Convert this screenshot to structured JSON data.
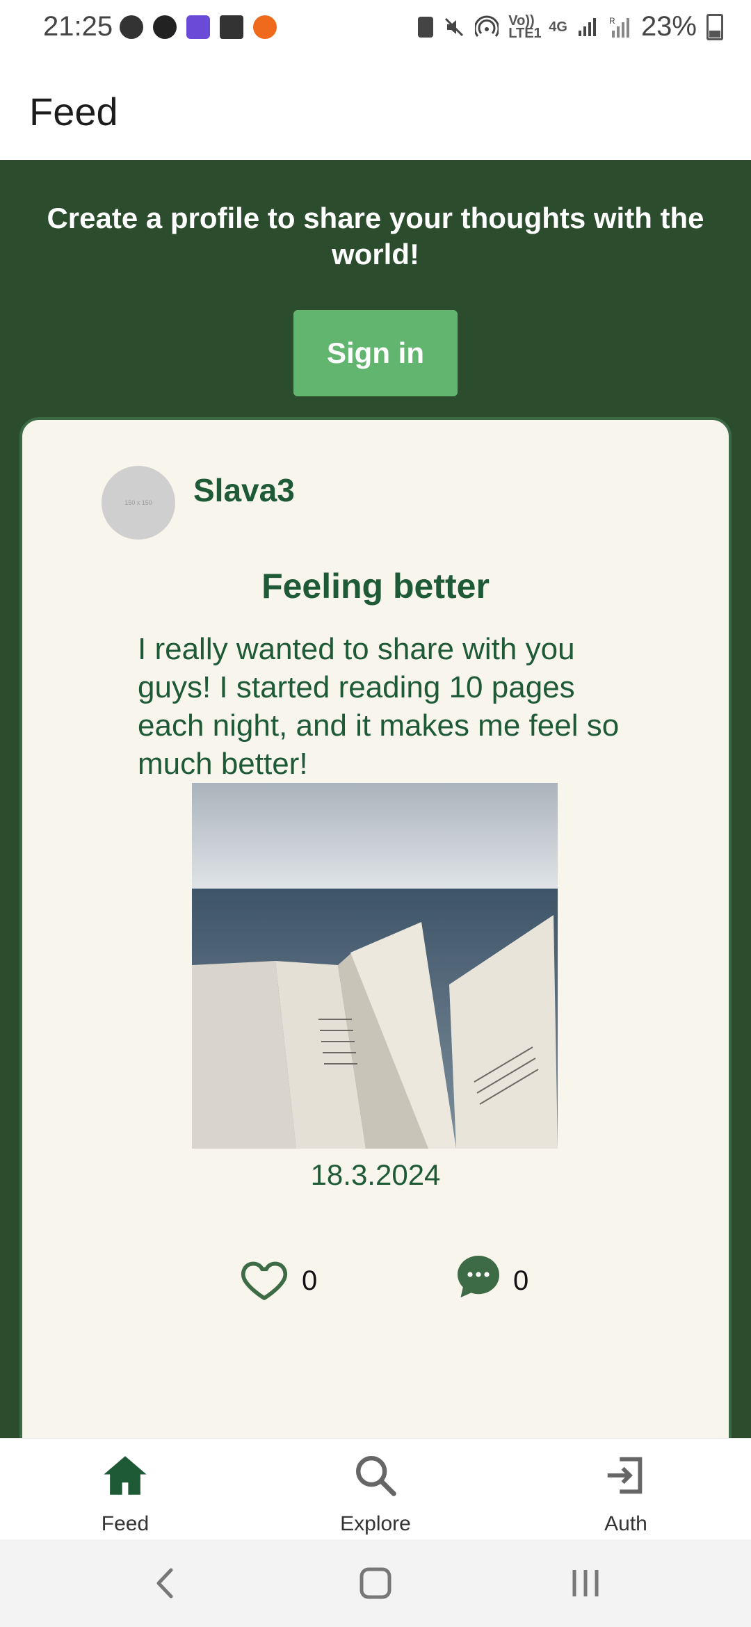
{
  "status_bar": {
    "time": "21:25",
    "battery": "23%",
    "left_icons": [
      "face-icon",
      "app-a-icon",
      "list-app-icon",
      "gallery-icon",
      "orange-dot-icon"
    ],
    "right_icons": [
      "battery-saver-icon",
      "mute-icon",
      "hotspot-icon",
      "volte-icon",
      "4g-icon",
      "signal-icon",
      "signal-roaming-icon"
    ],
    "volte_label": "Vo)) LTE1",
    "net_label": "4G",
    "roam_label": "R"
  },
  "header": {
    "title": "Feed"
  },
  "promo": {
    "text": "Create a profile to share your thoughts with the world!",
    "signin_label": "Sign in"
  },
  "post": {
    "avatar_placeholder": "150 x 150",
    "author": "Slava3",
    "title": "Feeling better",
    "body": "I really wanted to share with you guys! I started reading 10 pages each night, and it makes me feel so much better!",
    "image_desc_icon": "book-by-sea-photo",
    "date": "18.3.2024",
    "likes": "0",
    "comments": "0"
  },
  "bottom_nav": {
    "items": [
      {
        "label": "Feed",
        "icon": "home-icon",
        "active": true
      },
      {
        "label": "Explore",
        "icon": "search-icon",
        "active": false
      },
      {
        "label": "Auth",
        "icon": "login-icon",
        "active": false
      }
    ]
  },
  "colors": {
    "primary_green": "#2c4c2e",
    "accent_green": "#62b56e",
    "text_green": "#1e5a36",
    "card_bg": "#f8f5ec"
  }
}
